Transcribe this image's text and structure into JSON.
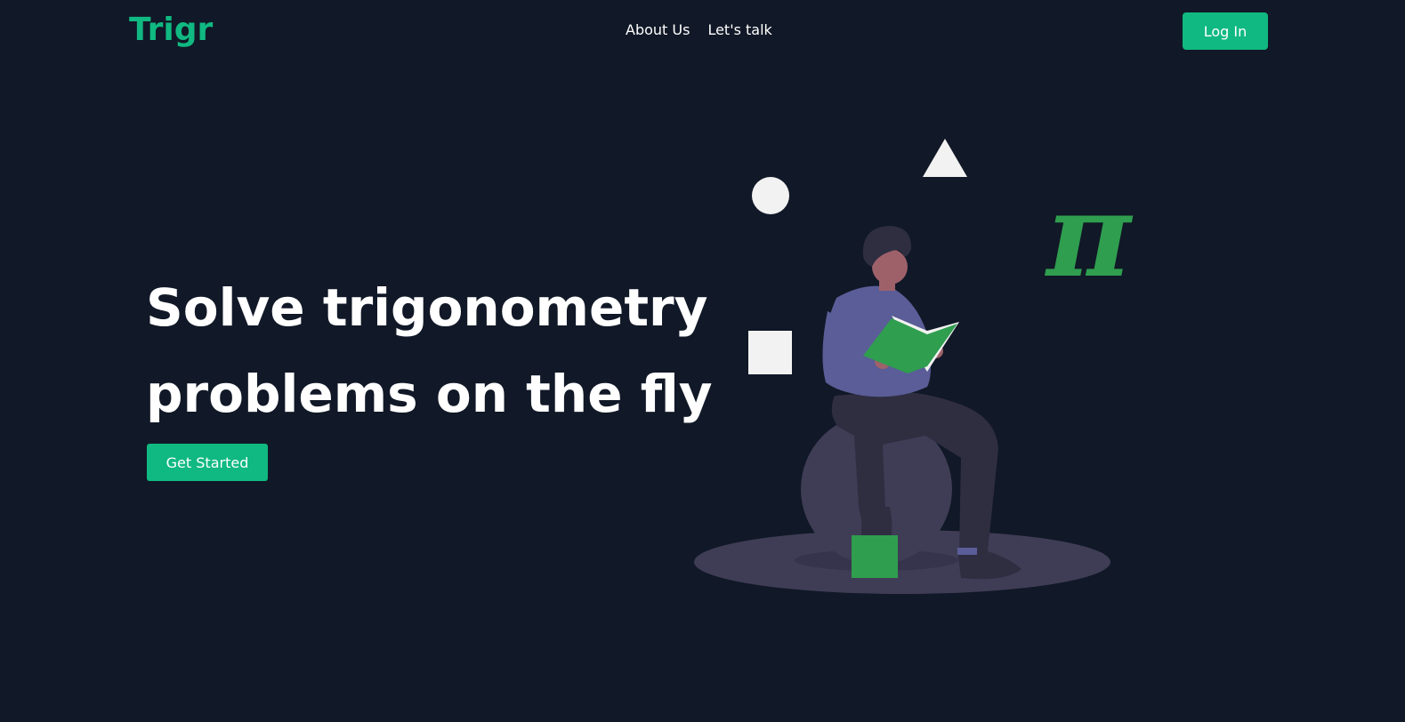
{
  "header": {
    "logo": "Trigr",
    "nav": [
      {
        "label": "About Us"
      },
      {
        "label": "Let's talk"
      }
    ],
    "login_label": "Log In"
  },
  "hero": {
    "title_line1": "Solve trigonometry",
    "title_line2": "problems on the fly",
    "cta_label": "Get Started"
  },
  "illustration": {
    "pi_symbol": "π",
    "icons": [
      "circle-shape",
      "triangle-shape",
      "square-shape",
      "pi-symbol",
      "person-reading-book"
    ]
  },
  "colors": {
    "background": "#111827",
    "accent": "#10b981",
    "illustration_green": "#2f9e4f",
    "shirt": "#5a5d97",
    "pants": "#2f2e41",
    "seat": "#3f3d56"
  }
}
